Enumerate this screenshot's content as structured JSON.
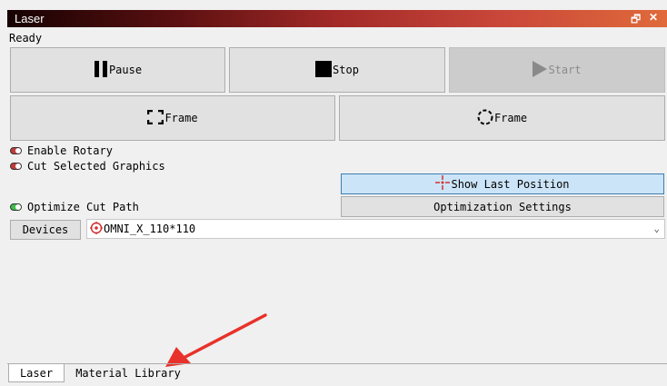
{
  "window": {
    "title": "Laser",
    "float_icon": "restore-window-icon",
    "close_icon": "close-icon"
  },
  "status": "Ready",
  "controls": {
    "pause_label": "Pause",
    "stop_label": "Stop",
    "start_label": "Start",
    "frame_square_label": "Frame",
    "frame_circle_label": "Frame"
  },
  "options": {
    "enable_rotary": {
      "label": "Enable Rotary",
      "state": "off"
    },
    "cut_selected": {
      "label": "Cut Selected Graphics",
      "state": "off"
    },
    "optimize_path": {
      "label": "Optimize Cut Path",
      "state": "on"
    }
  },
  "show_last_position_label": "Show Last Position",
  "optimization_settings_label": "Optimization Settings",
  "devices": {
    "button_label": "Devices",
    "selected": "OMNI_X_110*110"
  },
  "tabs": [
    {
      "label": "Laser",
      "active": true
    },
    {
      "label": "Material Library",
      "active": false
    }
  ],
  "colors": {
    "toggle_off": "#c23b3b",
    "toggle_on": "#3dbf4b",
    "annotation_arrow": "#e8312a",
    "highlight_button": "#cce4f7"
  }
}
